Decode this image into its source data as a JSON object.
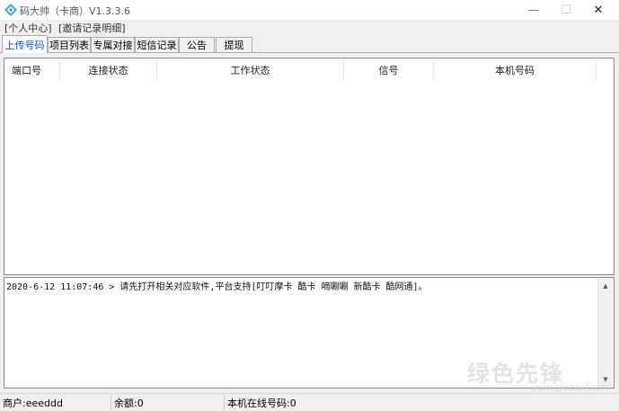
{
  "window": {
    "title": "码大帅（卡商）V1.3.3.6",
    "minimize_glyph": "—",
    "maximize_glyph": "☐",
    "close_glyph": "✕",
    "icon": "app-diamond-icon",
    "icon_color": "#3bb0e0"
  },
  "menu": {
    "items": [
      {
        "label": "[个人中心]"
      },
      {
        "label": "[邀请记录明细]"
      }
    ]
  },
  "tabs": [
    {
      "label": "上传号码",
      "active": true
    },
    {
      "label": "项目列表",
      "active": false
    },
    {
      "label": "专属对接",
      "active": false
    },
    {
      "label": "短信记录",
      "active": false
    },
    {
      "label": "公告",
      "active": false
    },
    {
      "label": "提现",
      "active": false
    }
  ],
  "table": {
    "columns": [
      "端口号",
      "连接状态",
      "工作状态",
      "信号",
      "本机号码"
    ],
    "rows": []
  },
  "log": {
    "lines": [
      "2020-6-12 11:07:46 > 请先打开相关对应软件,平台支持[叮叮摩卡 酷卡 嘀唰唰 新酷卡 酷网通]。"
    ]
  },
  "status": {
    "merchant": "商户:eeeddd",
    "balance": "余额:0",
    "online_numbers": "本机在线号码:0"
  },
  "watermark": {
    "text": "绿色先锋",
    "url": "www.greenxf.com"
  },
  "colors": {
    "active_tab_text": "#0050ff",
    "border": "#828790",
    "background": "#f0f0f0"
  }
}
